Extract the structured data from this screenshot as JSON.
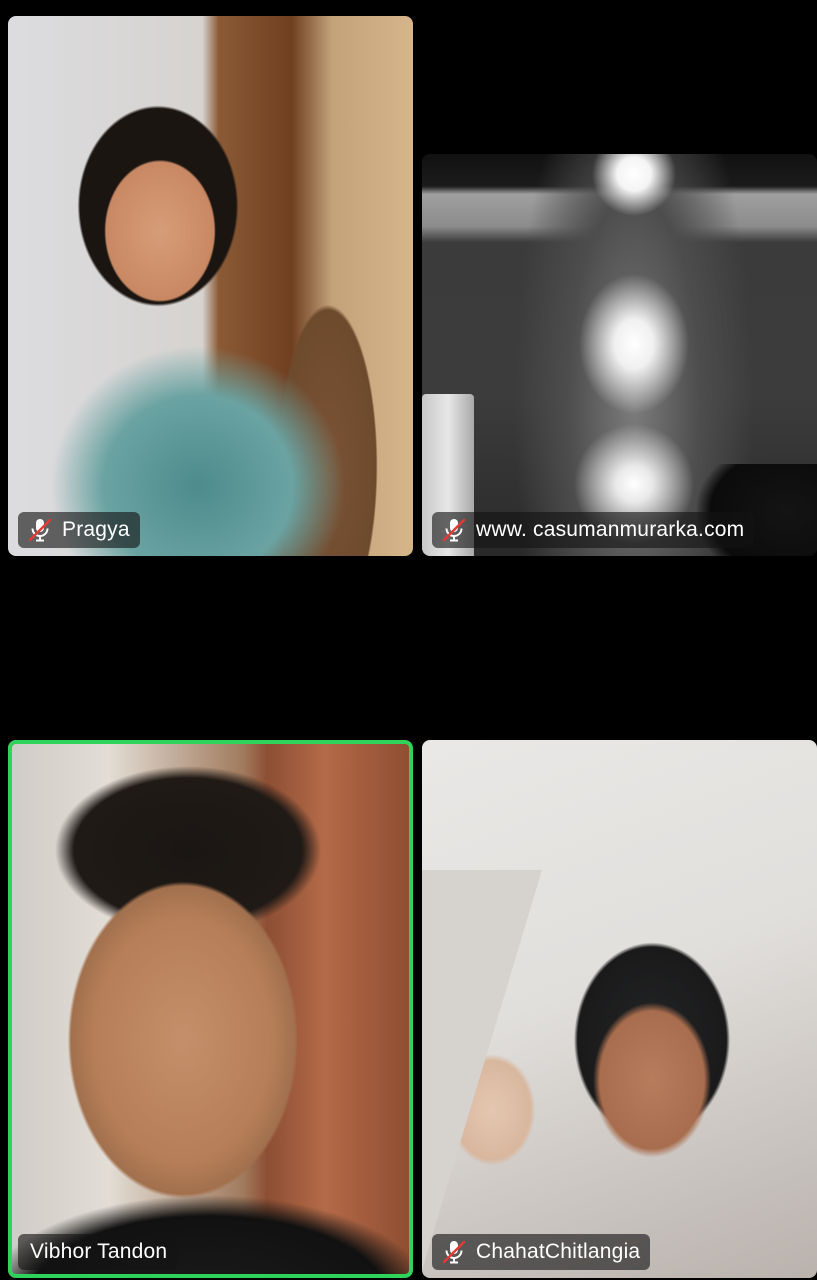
{
  "participants": [
    {
      "name": "Pragya",
      "muted": true,
      "active_speaker": false
    },
    {
      "name": "www. casumanmurarka.com",
      "muted": true,
      "active_speaker": false
    },
    {
      "name": "Vibhor Tandon",
      "muted": false,
      "active_speaker": true
    },
    {
      "name": "ChahatChitlangia",
      "muted": true,
      "active_speaker": false
    }
  ],
  "icons": {
    "muted_mic": "mic-muted-icon"
  },
  "colors": {
    "background": "#000000",
    "active_speaker_border": "#2fd35a",
    "muted_slash": "#e53935",
    "name_tag_bg": "rgba(20,20,20,0.62)"
  }
}
